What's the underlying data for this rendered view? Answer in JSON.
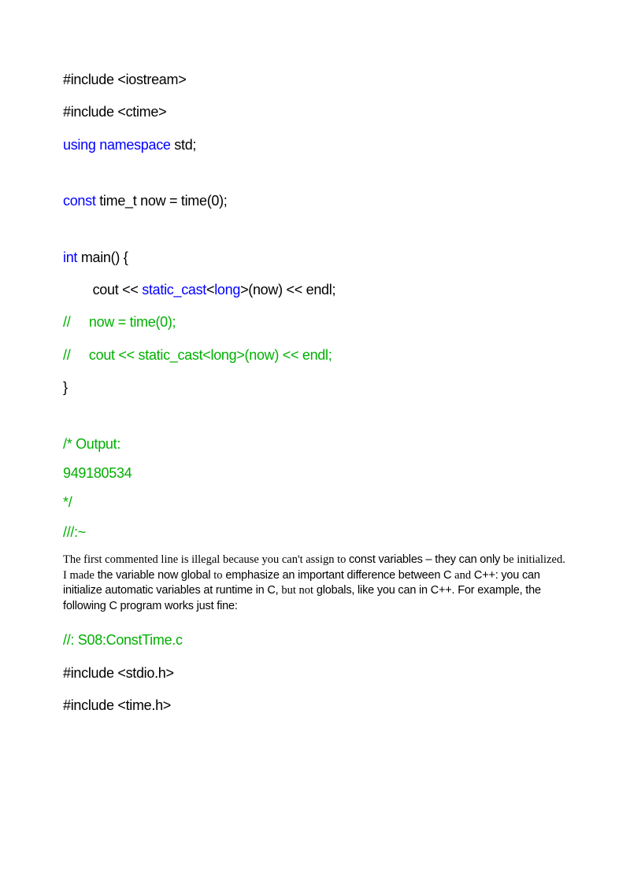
{
  "code1": {
    "l1_a": "#include",
    "l1_b": " <iostream>",
    "l2_a": "#include",
    "l2_b": " <ctime>",
    "l3_a": "using",
    "l3_b": " namespace",
    "l3_c": " std;",
    "l4_a": "const",
    "l4_b": " time_t now = time(0);",
    "l5_a": "int",
    "l5_b": " main() {",
    "l6_a": "        cout << ",
    "l6_b": "static_cast",
    "l6_c": "<",
    "l6_d": "long",
    "l6_e": ">(now) << endl;",
    "l7": "//     now = time(0);",
    "l8": "//     cout << static_cast<long>(now) << endl;",
    "l9": "}",
    "l10": "/* Output:",
    "l11": "949180534",
    "l12": "*/",
    "l13": "///:~"
  },
  "para": {
    "t1": "The first commented line is illegal because you can't assign to ",
    "t2": "const",
    "t3": " variables – they can only ",
    "t4": "be initialized. I ",
    "t5": "made",
    "t6": " the variable now global ",
    "t7": "to",
    "t8": " emphasize an important difference between C ",
    "t9": "and",
    "t10": " C++: you can initialize automatic variables at runtime in C, ",
    "t11": "but not",
    "t12": " globals, like you can in C++. For example, the following C program works just fine:"
  },
  "code2": {
    "l1": "//: S08:ConstTime.c",
    "l2_a": "#include",
    "l2_b": " <stdio.h>",
    "l3_a": "#include",
    "l3_b": " <time.h>"
  }
}
